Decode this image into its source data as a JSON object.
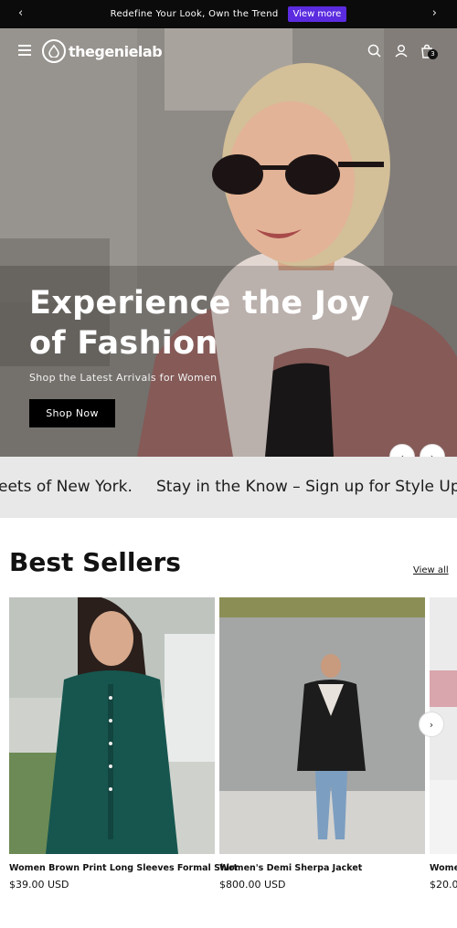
{
  "announcement": {
    "message": "Redefine Your Look, Own the Trend",
    "button": "View more",
    "prev": "‹",
    "next": "›"
  },
  "header": {
    "logo_text": "thegenielab",
    "cart_count": "3"
  },
  "hero": {
    "title": "Experience the Joy of Fashion",
    "subtitle": "Shop the Latest Arrivals for Women",
    "button": "Shop Now",
    "prev": "‹",
    "next": "›"
  },
  "marquee": {
    "items": [
      "eets of New York.",
      "Stay in the Know – Sign up for Style Upde"
    ]
  },
  "best_sellers": {
    "title": "Best Sellers",
    "view_all": "View all",
    "next": "›",
    "products": [
      {
        "name": "Women Brown Print Long Sleeves Formal Shirt",
        "price": "$39.00 USD"
      },
      {
        "name": "Women's Demi Sherpa Jacket",
        "price": "$800.00 USD"
      },
      {
        "name": "Wome",
        "price": "$20.0"
      }
    ]
  },
  "colors": {
    "announcement_bg": "#0b0b0b",
    "accent": "#5b2be0",
    "marquee_bg": "#e8e8e8"
  }
}
